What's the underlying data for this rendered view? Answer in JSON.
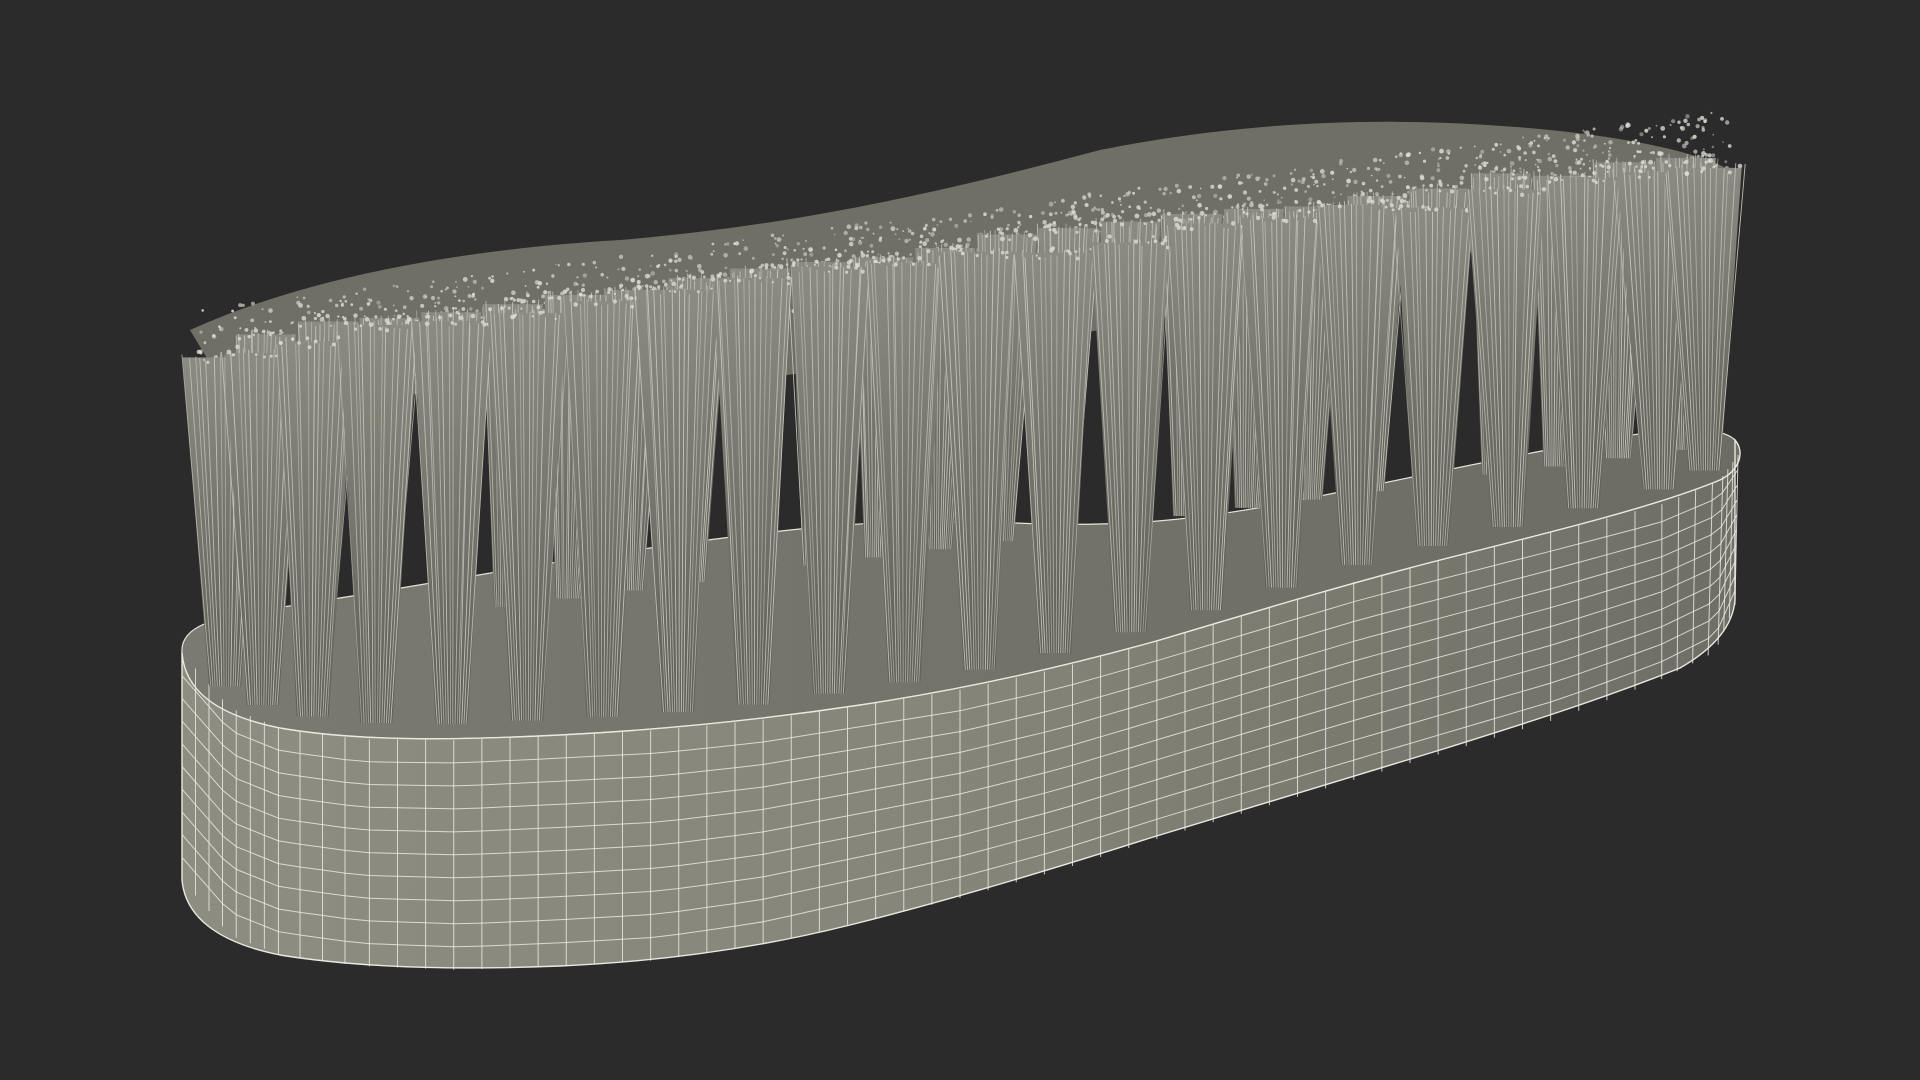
{
  "render": {
    "subject": "scrub-brush-wireframe",
    "colors": {
      "background": "#2b2b2b",
      "body_fill": "#8a8a7e",
      "body_shade": "#6f6f65",
      "top_fill": "#7d7d72",
      "wire": "#e9e9e1",
      "bristle_fill": "#77776d",
      "bristle_wire": "#c9c9c0",
      "bristle_tip": "#dcdcd4"
    },
    "icons": {
      "base": "brush-body-icon",
      "bristles": "bristle-tuft-icon"
    }
  }
}
